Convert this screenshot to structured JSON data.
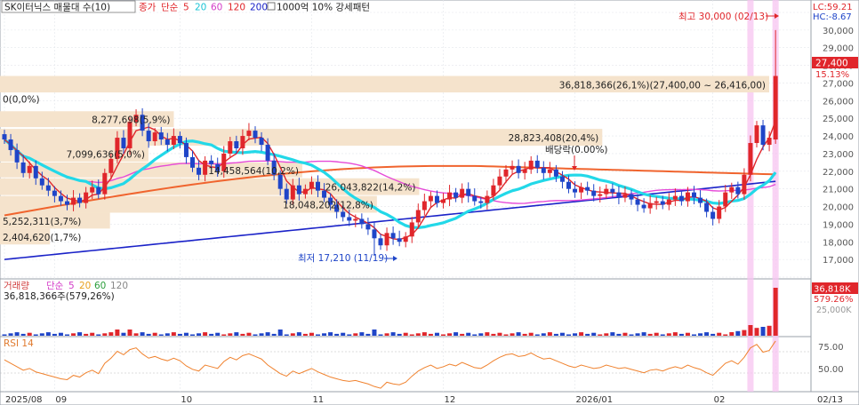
{
  "header": {
    "stock_name": "SK이터닉스 매물대 수(10)",
    "close_label": "종가",
    "ma_label": "단순",
    "ma_periods": [
      "5",
      "20",
      "60",
      "120",
      "200"
    ],
    "extra": "1000억 10% 강세패턴"
  },
  "right_panel": {
    "lc": "LC:59.21",
    "hc": "HC:-8.67",
    "price_badge": "27,400",
    "pct_badge": "15.13%",
    "vol_badge": "36,818K",
    "vol_pct_badge": "579.26%"
  },
  "price_axis": {
    "ylim": [
      16000,
      31000
    ],
    "ticks": [
      17000,
      18000,
      19000,
      20000,
      21000,
      22000,
      23000,
      24000,
      25000,
      26000,
      27000,
      28000,
      29000,
      30000
    ]
  },
  "annotations": {
    "high_label": "최고 30,000 (02/13)",
    "low_label": "최저 17,210 (11/19)",
    "dividend_label": "배당락(0.00%)"
  },
  "volume_profile": [
    {
      "label": "36,818,366(26,1%)(27,400,00 ~ 26,416,00)",
      "low": 26416,
      "high": 27400,
      "frac": 1.0
    },
    {
      "label": "8,277,698(5,9%)",
      "low": 24450,
      "high": 25400,
      "frac": 0.226
    },
    {
      "label": "28,823,408(20,4%)",
      "low": 23400,
      "high": 24400,
      "frac": 0.783
    },
    {
      "label": "7,099,636(5,0%)",
      "low": 22500,
      "high": 23450,
      "frac": 0.193
    },
    {
      "label": "14,458,564(10,2%)",
      "low": 21600,
      "high": 22500,
      "frac": 0.393
    },
    {
      "label": "26,043,822(14,2%)",
      "low": 20600,
      "high": 21600,
      "frac": 0.545
    },
    {
      "label": "18,048,202(12,8%)",
      "low": 19600,
      "high": 20600,
      "frac": 0.49
    },
    {
      "label": "5,252,311(3,7%)",
      "low": 18700,
      "high": 19650,
      "frac": 0.143
    },
    {
      "label": "2,404,620(1,7%)",
      "low": 17800,
      "high": 18750,
      "frac": 0.065
    },
    {
      "label": "0(0,0%)",
      "low": 26416,
      "high": 25400,
      "frac": 0.0
    }
  ],
  "volume_panel": {
    "title": "거래량",
    "ma_label": "단순",
    "ma_periods": [
      "5",
      "20",
      "60",
      "120"
    ],
    "summary": "36,818,366주(579,26%)",
    "ticks": [
      "25,000K"
    ]
  },
  "rsi_panel": {
    "title": "RSI 14",
    "ticks": [
      "75.00",
      "50.00"
    ]
  },
  "x_axis": {
    "labels": [
      {
        "text": "2025/08",
        "idx": 0
      },
      {
        "text": "09",
        "idx": 8
      },
      {
        "text": "10",
        "idx": 28
      },
      {
        "text": "11",
        "idx": 49
      },
      {
        "text": "12",
        "idx": 70
      },
      {
        "text": "2026/01",
        "idx": 91
      },
      {
        "text": "02",
        "idx": 113
      },
      {
        "text": "02/13",
        "idx": 123
      }
    ]
  },
  "colors": {
    "up": "#e0262b",
    "down": "#1f45c8",
    "ma5": "#e0262b",
    "ma20": "#22d8e8",
    "ma60": "#e64ad8",
    "ma120": "#f0642e",
    "ma200": "#1a22c8",
    "profile": "#f5e3cc",
    "highlight": "#f7c4f0"
  },
  "chart_data": {
    "type": "candlestick",
    "ylim": [
      16000,
      31000
    ],
    "highlight_indices": [
      119,
      123
    ],
    "closes": [
      23800,
      23200,
      22500,
      21900,
      22300,
      21600,
      21200,
      20900,
      20600,
      20300,
      20100,
      20500,
      20200,
      20800,
      21100,
      20700,
      21900,
      22700,
      23900,
      23300,
      24800,
      25200,
      24300,
      23700,
      24200,
      23800,
      23500,
      24000,
      23600,
      22800,
      22200,
      21800,
      22600,
      22400,
      22000,
      23000,
      23700,
      23300,
      24000,
      24300,
      23900,
      23500,
      22600,
      21800,
      21000,
      20400,
      21200,
      20700,
      21000,
      21400,
      20900,
      20500,
      20100,
      19700,
      19400,
      19200,
      19300,
      19000,
      18700,
      18200,
      17800,
      18500,
      18200,
      18000,
      18300,
      19100,
      19800,
      20300,
      20600,
      20200,
      20400,
      20800,
      20500,
      21000,
      20600,
      20300,
      20200,
      20600,
      21200,
      21700,
      22100,
      22300,
      21900,
      22100,
      22600,
      22200,
      21900,
      22100,
      21700,
      21400,
      21000,
      20800,
      21100,
      20900,
      20600,
      20700,
      21000,
      20800,
      20500,
      20700,
      20400,
      20100,
      19900,
      20200,
      20300,
      20100,
      20400,
      20600,
      20300,
      20800,
      20500,
      20200,
      19700,
      19300,
      20000,
      20800,
      21100,
      20700,
      21800,
      23600,
      24600,
      23500,
      23900,
      27400
    ],
    "rsi": [
      56,
      52,
      48,
      44,
      46,
      42,
      40,
      38,
      36,
      34,
      33,
      38,
      36,
      41,
      44,
      40,
      52,
      58,
      66,
      62,
      68,
      70,
      63,
      58,
      60,
      57,
      55,
      58,
      55,
      49,
      45,
      43,
      50,
      48,
      46,
      54,
      59,
      56,
      61,
      63,
      60,
      57,
      50,
      45,
      40,
      37,
      43,
      40,
      43,
      46,
      42,
      39,
      36,
      34,
      32,
      31,
      32,
      30,
      28,
      25,
      23,
      30,
      28,
      27,
      30,
      37,
      43,
      47,
      50,
      46,
      48,
      51,
      49,
      53,
      50,
      47,
      46,
      50,
      55,
      59,
      62,
      63,
      60,
      61,
      64,
      60,
      57,
      58,
      55,
      52,
      49,
      47,
      50,
      48,
      46,
      47,
      50,
      48,
      46,
      47,
      45,
      43,
      41,
      44,
      45,
      43,
      46,
      48,
      46,
      50,
      47,
      45,
      41,
      38,
      45,
      52,
      55,
      51,
      59,
      70,
      74,
      65,
      67,
      78
    ],
    "volume_note": "last bar 36,818,366"
  }
}
